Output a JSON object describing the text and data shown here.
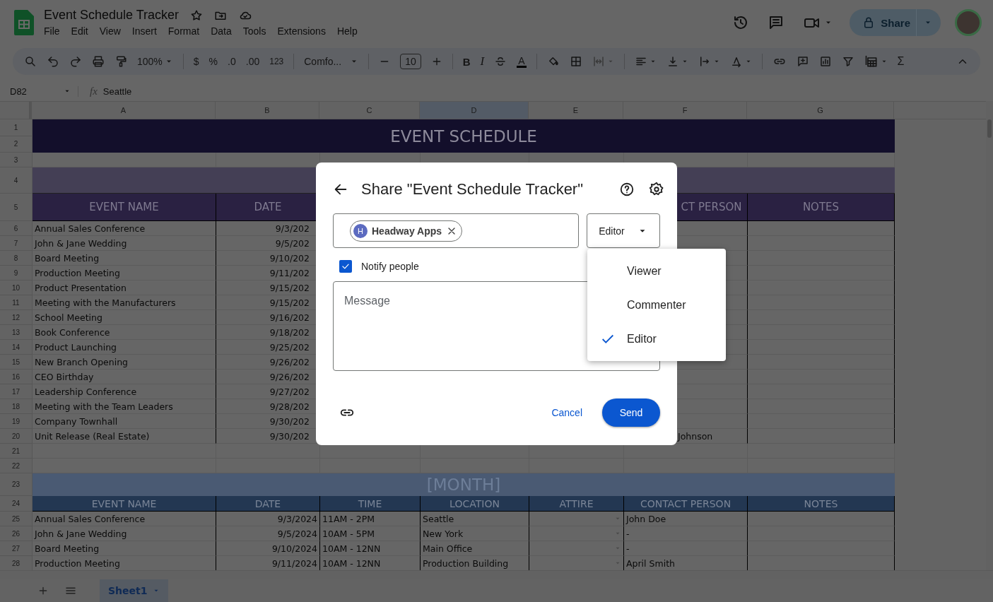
{
  "app": {
    "title": "Event Schedule Tracker",
    "menus": [
      "File",
      "Edit",
      "View",
      "Insert",
      "Format",
      "Data",
      "Tools",
      "Extensions",
      "Help"
    ],
    "share_label": "Share"
  },
  "toolbar": {
    "zoom": "100%",
    "currency": "$",
    "percent": "%",
    "decrease_decimal": ".0",
    "increase_decimal": ".00",
    "number_format": "123",
    "font": "Comfo...",
    "font_size": "10",
    "bold": "B",
    "italic": "I",
    "text_color": "A",
    "sum": "Σ"
  },
  "formula_bar": {
    "cell": "D82",
    "fx": "fx",
    "value": "Seattle"
  },
  "columns": [
    {
      "label": "A",
      "selected": false
    },
    {
      "label": "B",
      "selected": false
    },
    {
      "label": "C",
      "selected": false
    },
    {
      "label": "D",
      "selected": true
    },
    {
      "label": "E",
      "selected": false
    },
    {
      "label": "F",
      "selected": false
    },
    {
      "label": "G",
      "selected": false
    }
  ],
  "rows": [
    {
      "numbers": [
        "1",
        "2"
      ],
      "kind": "title",
      "text": "EVENT SCHEDULE"
    },
    {
      "numbers": [
        "3"
      ],
      "kind": "blank"
    },
    {
      "numbers": [
        "4"
      ],
      "kind": "band"
    },
    {
      "numbers": [
        "5"
      ],
      "kind": "header",
      "cells": {
        "A": "EVENT NAME",
        "B": "DATE",
        "G": "NOTES"
      },
      "partial": {
        "F": "CT PERSON"
      }
    },
    {
      "numbers": [
        "6"
      ],
      "kind": "data",
      "cells": {
        "A": "Annual Sales Conference"
      },
      "partial": {
        "B": "9/3/202"
      }
    },
    {
      "numbers": [
        "7"
      ],
      "kind": "data",
      "cells": {
        "A": "John & Jane Wedding"
      },
      "partial": {
        "B": "9/5/202"
      }
    },
    {
      "numbers": [
        "8"
      ],
      "kind": "data",
      "cells": {
        "A": "Board Meeting"
      },
      "partial": {
        "B": "9/10/202"
      }
    },
    {
      "numbers": [
        "9"
      ],
      "kind": "data",
      "cells": {
        "A": "Production Meeting"
      },
      "partial": {
        "B": "9/11/202"
      }
    },
    {
      "numbers": [
        "10"
      ],
      "kind": "data",
      "cells": {
        "A": "Product Presentation"
      },
      "partial": {
        "B": "9/15/202"
      }
    },
    {
      "numbers": [
        "11"
      ],
      "kind": "data",
      "cells": {
        "A": "Meeting with the Manufacturers"
      },
      "partial": {
        "B": "9/15/202"
      }
    },
    {
      "numbers": [
        "12"
      ],
      "kind": "data",
      "cells": {
        "A": "School Meeting"
      },
      "partial": {
        "B": "9/16/202"
      }
    },
    {
      "numbers": [
        "13"
      ],
      "kind": "data",
      "cells": {
        "A": "Book Conference"
      },
      "partial": {
        "B": "9/18/202"
      }
    },
    {
      "numbers": [
        "14"
      ],
      "kind": "data",
      "cells": {
        "A": "Product Launching"
      },
      "partial": {
        "B": "9/25/202"
      }
    },
    {
      "numbers": [
        "15"
      ],
      "kind": "data",
      "cells": {
        "A": "New Branch Opening"
      },
      "partial": {
        "B": "9/26/202"
      }
    },
    {
      "numbers": [
        "16"
      ],
      "kind": "data",
      "cells": {
        "A": "CEO Birthday"
      },
      "partial": {
        "B": "9/26/202"
      }
    },
    {
      "numbers": [
        "17"
      ],
      "kind": "data",
      "cells": {
        "A": "Leadership Conference"
      },
      "partial": {
        "B": "9/27/202"
      }
    },
    {
      "numbers": [
        "18"
      ],
      "kind": "data",
      "cells": {
        "A": "Meeting with the Team Leaders"
      },
      "partial": {
        "B": "9/28/202"
      }
    },
    {
      "numbers": [
        "19"
      ],
      "kind": "data",
      "cells": {
        "A": "Company Townhall"
      },
      "partial": {
        "B": "9/30/202"
      }
    },
    {
      "numbers": [
        "20"
      ],
      "kind": "data",
      "cells": {
        "A": "Unit Release (Real Estate)"
      },
      "partial": {
        "B": "9/30/202",
        "F": "Johnson"
      }
    },
    {
      "numbers": [
        "21"
      ],
      "kind": "blank"
    },
    {
      "numbers": [
        "22"
      ],
      "kind": "blank"
    },
    {
      "numbers": [
        "23"
      ],
      "kind": "month",
      "text": "[MONTH]"
    },
    {
      "numbers": [
        "24"
      ],
      "kind": "header2",
      "cells": {
        "A": "EVENT NAME",
        "B": "DATE",
        "C": "TIME",
        "D": "LOCATION",
        "E": "ATTIRE",
        "F": "CONTACT PERSON",
        "G": "NOTES"
      }
    },
    {
      "numbers": [
        "25"
      ],
      "kind": "data2",
      "cells": {
        "A": "Annual Sales Conference",
        "B": "9/3/2024",
        "C": "11AM - 2PM",
        "D": "Seattle",
        "F": "John Doe"
      }
    },
    {
      "numbers": [
        "26"
      ],
      "kind": "data2",
      "cells": {
        "A": "John & Jane Wedding",
        "B": "9/5/2024",
        "C": "10AM - 5PM",
        "D": "New York",
        "F": "-"
      }
    },
    {
      "numbers": [
        "27"
      ],
      "kind": "data2",
      "cells": {
        "A": "Board Meeting",
        "B": "9/10/2024",
        "C": "10AM - 12NN",
        "D": "Main Office",
        "F": "-"
      }
    },
    {
      "numbers": [
        "28"
      ],
      "kind": "data2",
      "cells": {
        "A": "Production Meeting",
        "B": "9/11/2024",
        "C": "10AM - 12NN",
        "D": "Production Building",
        "F": "April Smith"
      }
    }
  ],
  "sheet_tabs": [
    {
      "label": "Sheet1",
      "selected": true
    }
  ],
  "dialog": {
    "title": "Share \"Event Schedule Tracker\"",
    "chip": {
      "initial": "H",
      "name": "Headway Apps"
    },
    "role": "Editor",
    "notify": {
      "label": "Notify people",
      "checked": true
    },
    "message_placeholder": "Message",
    "cancel": "Cancel",
    "send": "Send",
    "role_options": [
      {
        "label": "Viewer",
        "selected": false
      },
      {
        "label": "Commenter",
        "selected": false
      },
      {
        "label": "Editor",
        "selected": true
      }
    ]
  }
}
